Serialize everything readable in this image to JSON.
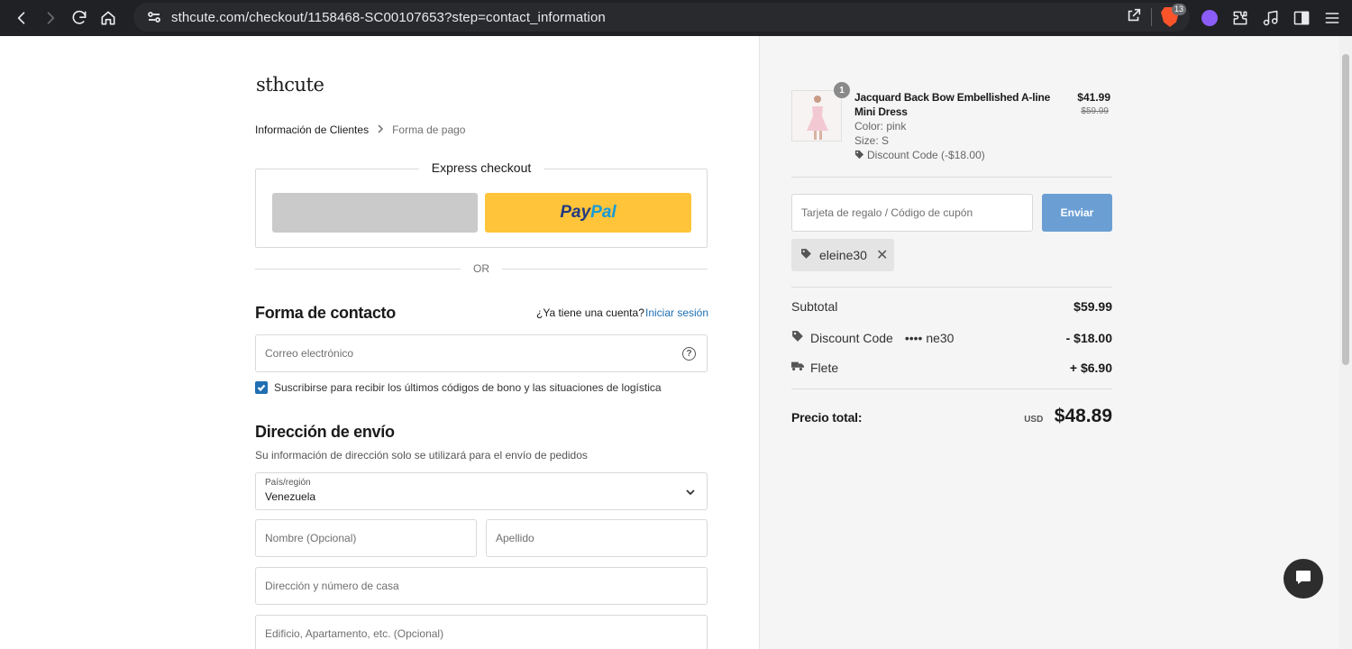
{
  "browser": {
    "url": "sthcute.com/checkout/1158468-SC00107653?step=contact_information",
    "brave_badge": "13"
  },
  "left": {
    "logo": "sthcute",
    "breadcrumb": [
      "Información de Clientes",
      "Forma de pago"
    ],
    "express": {
      "title": "Express checkout",
      "paypal_pay": "Pay",
      "paypal_pal": "Pal"
    },
    "or_label": "OR",
    "contact": {
      "heading": "Forma de contacto",
      "account_question": "¿Ya tiene una cuenta?",
      "login_link": "Iniciar sesión",
      "email_placeholder": "Correo electrónico",
      "help_glyph": "?",
      "subscribe_label": "Suscribirse para recibir los últimos códigos de bono y las situaciones de logística",
      "subscribe_checked": true
    },
    "shipping": {
      "heading": "Dirección de envío",
      "note": "Su información de dirección solo se utilizará para el envío de pedidos",
      "country_label": "País/región",
      "country_value": "Venezuela",
      "first_name_placeholder": "Nombre (Opcional)",
      "last_name_placeholder": "Apellido",
      "address_placeholder": "Dirección y número de casa",
      "address2_placeholder": "Edificio, Apartamento, etc. (Opcional)"
    }
  },
  "right": {
    "product": {
      "quantity": "1",
      "name": "Jacquard Back Bow Embellished A-line Mini Dress",
      "color": "Color: pink",
      "size": "Size: S",
      "discount": "Discount Code (-$18.00)",
      "price": "$41.99",
      "original_price": "$59.99"
    },
    "coupon": {
      "placeholder": "Tarjeta de regalo / Código de cupón",
      "button": "Enviar",
      "applied_code": "eleine30",
      "remove_glyph": "✕"
    },
    "summary": {
      "subtotal_label": "Subtotal",
      "subtotal_value": "$59.99",
      "discount_label": "Discount Code",
      "discount_masked": "•••• ne30",
      "discount_value": "- $18.00",
      "shipping_label": "Flete",
      "shipping_value": "+ $6.90",
      "total_label": "Precio total:",
      "total_currency": "USD",
      "total_value": "$48.89"
    }
  },
  "colors": {
    "link": "#1f6fb2",
    "paypal_yellow": "#ffc439",
    "send_button": "#6b9fd4",
    "panel_bg": "#f5f5f5"
  }
}
